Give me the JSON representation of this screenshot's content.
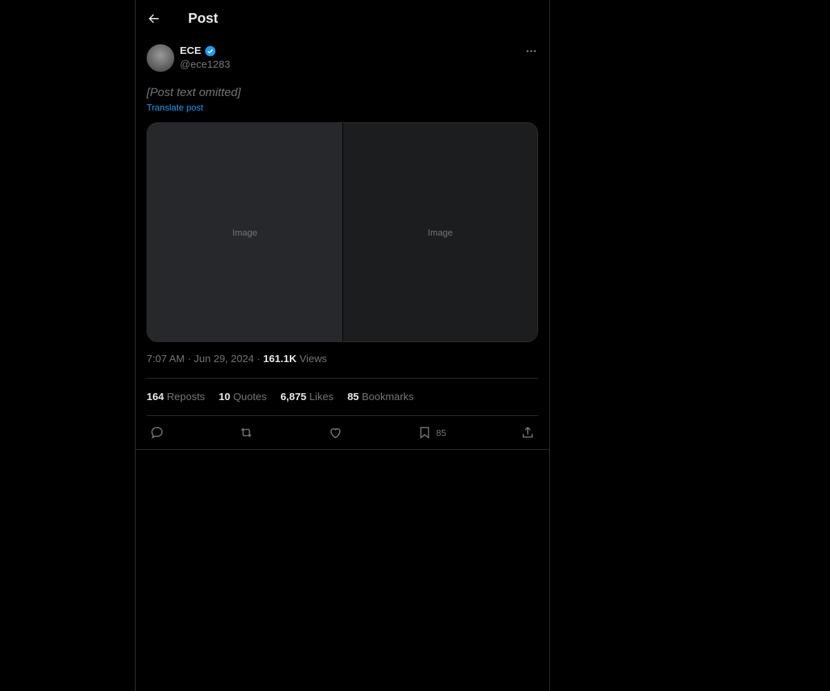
{
  "header": {
    "title": "Post"
  },
  "author": {
    "display_name": "ECE",
    "handle": "@ece1283",
    "verified": true
  },
  "post": {
    "text_notice": "[Post text omitted]",
    "translate_label": "Translate post",
    "media_left_label": "Image",
    "media_right_label": "Image"
  },
  "meta": {
    "time": "7:07 AM",
    "separator": "·",
    "date": "Jun 29, 2024",
    "views_count": "161.1K",
    "views_label": "Views"
  },
  "stats": {
    "reposts_count": "164",
    "reposts_label": "Reposts",
    "quotes_count": "10",
    "quotes_label": "Quotes",
    "likes_count": "6,875",
    "likes_label": "Likes",
    "bookmarks_count": "85",
    "bookmarks_label": "Bookmarks"
  },
  "actions": {
    "bookmark_count": "85"
  },
  "icons": [
    "back-arrow-icon",
    "verified-badge-icon",
    "more-options-icon",
    "reply-icon",
    "repost-icon",
    "like-icon",
    "bookmark-icon",
    "share-icon"
  ],
  "colors": {
    "background": "#000000",
    "text": "#e7e9ea",
    "muted": "#71767b",
    "accent": "#1d9bf0",
    "border": "#2f3336"
  }
}
